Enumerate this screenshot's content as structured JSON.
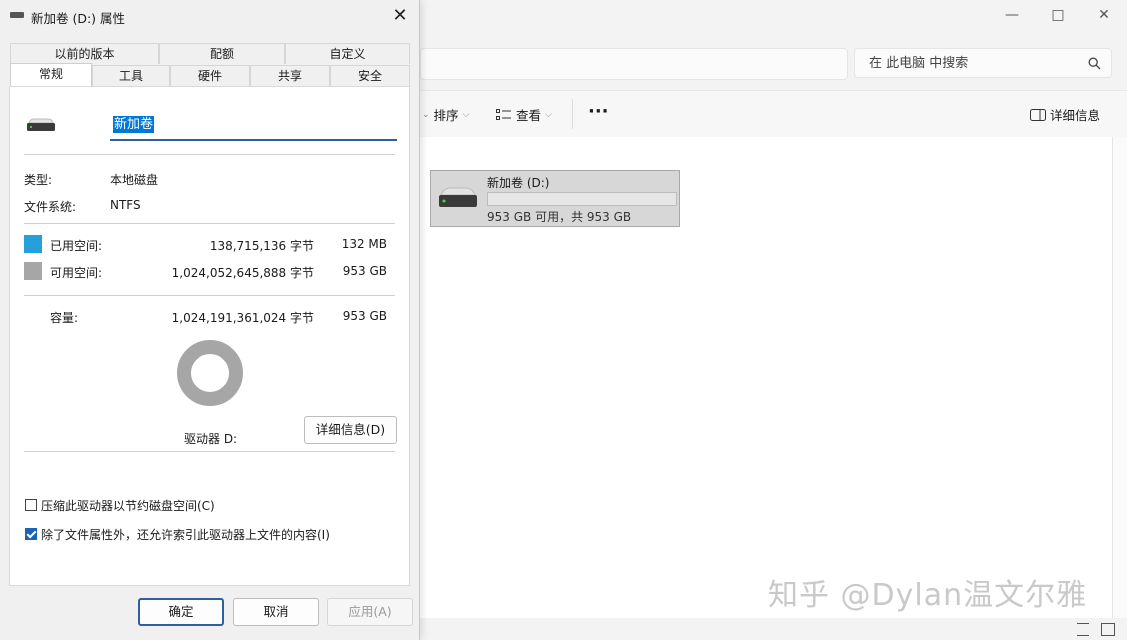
{
  "dialog": {
    "title": "新加卷 (D:) 属性",
    "tabs_top": [
      "以前的版本",
      "配额",
      "自定义"
    ],
    "tabs_bottom": [
      "常规",
      "工具",
      "硬件",
      "共享",
      "安全"
    ],
    "volume_name": "新加卷",
    "type_label": "类型:",
    "type_value": "本地磁盘",
    "fs_label": "文件系统:",
    "fs_value": "NTFS",
    "used_label": "已用空间:",
    "used_bytes": "138,715,136 字节",
    "used_size": "132 MB",
    "free_label": "可用空间:",
    "free_bytes": "1,024,052,645,888 字节",
    "free_size": "953 GB",
    "capacity_label": "容量:",
    "capacity_bytes": "1,024,191,361,024 字节",
    "capacity_size": "953 GB",
    "used_fraction": 0.000135,
    "drive_label": "驱动器 D:",
    "details_button": "详细信息(D)",
    "compress_label": "压缩此驱动器以节约磁盘空间(C)",
    "compress_checked": false,
    "index_label": "除了文件属性外，还允许索引此驱动器上文件的内容(I)",
    "index_checked": true,
    "ok_button": "确定",
    "cancel_button": "取消",
    "apply_button": "应用(A)",
    "colors": {
      "used": "#26a0da",
      "free": "#a6a6a6"
    }
  },
  "explorer": {
    "search_placeholder": "在 此电脑 中搜索",
    "toolbar": {
      "sort": "排序",
      "view": "查看",
      "more": "···",
      "details": "详细信息"
    },
    "drive_tile": {
      "name": "新加卷 (D:)",
      "capacity_text": "953 GB 可用，共 953 GB",
      "used_fraction": 0.000135
    }
  },
  "watermark": "知乎 @Dylan温文尔雅"
}
